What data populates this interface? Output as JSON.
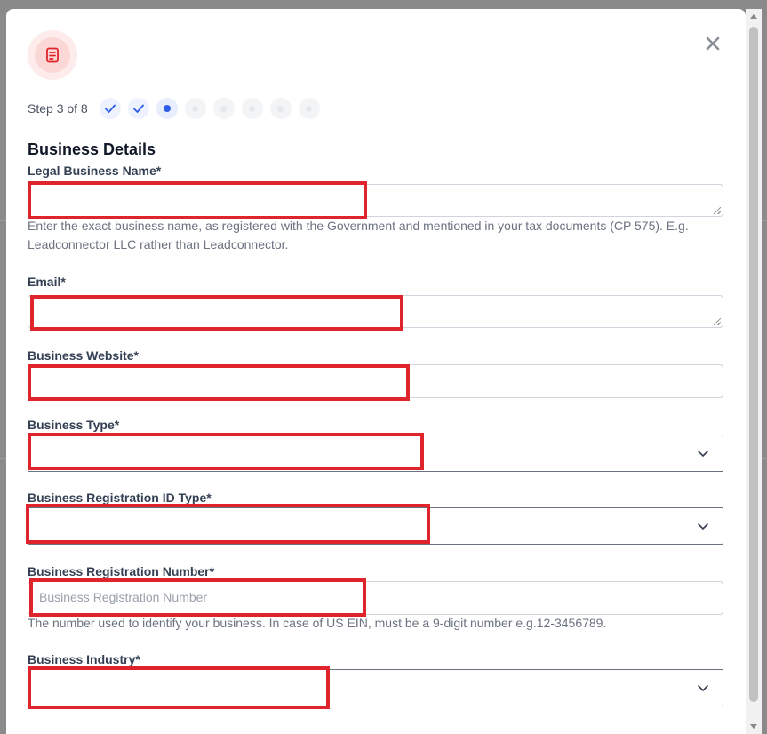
{
  "stepper": {
    "label": "Step 3 of 8",
    "total": 8,
    "completed": 2,
    "current": 3
  },
  "section_title": "Business Details",
  "fields": {
    "legal_name": {
      "label": "Legal Business Name*",
      "value": "",
      "help": "Enter the exact business name, as registered with the Government and mentioned in your tax documents (CP 575). E.g. Leadconnector LLC rather than Leadconnector."
    },
    "email": {
      "label": "Email*",
      "value": ""
    },
    "website": {
      "label": "Business Website*",
      "value": ""
    },
    "business_type": {
      "label": "Business Type*",
      "selected": ""
    },
    "registration_id_type": {
      "label": "Business Registration ID Type*",
      "selected": ""
    },
    "registration_number": {
      "label": "Business Registration Number*",
      "placeholder": "Business Registration Number",
      "help": "The number used to identify your business. In case of US EIN, must be a 9-digit number e.g.12-3456789."
    },
    "industry": {
      "label": "Business Industry*",
      "selected": ""
    }
  },
  "icons": {
    "header": "document-icon",
    "close": "close-icon",
    "chevron": "chevron-down-icon",
    "check": "check-icon"
  },
  "colors": {
    "accent": "#2f5ee8",
    "brand_icon": "#e0242b",
    "highlight": "#e0242b"
  }
}
